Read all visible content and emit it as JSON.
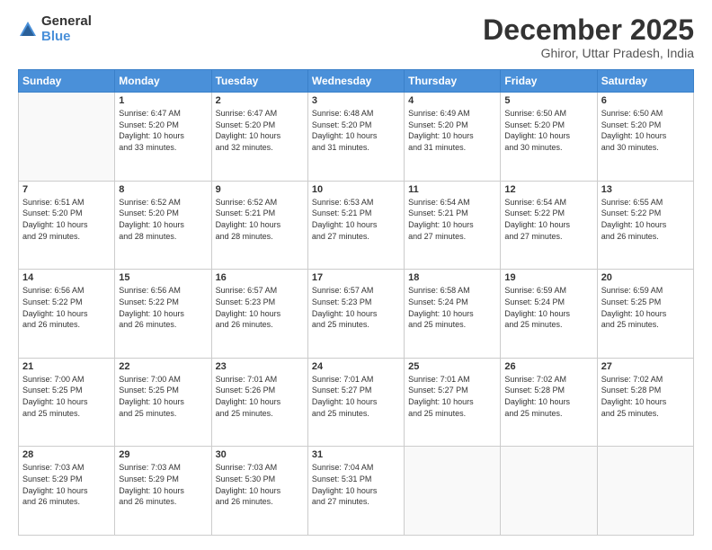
{
  "logo": {
    "general": "General",
    "blue": "Blue"
  },
  "header": {
    "month": "December 2025",
    "location": "Ghiror, Uttar Pradesh, India"
  },
  "weekdays": [
    "Sunday",
    "Monday",
    "Tuesday",
    "Wednesday",
    "Thursday",
    "Friday",
    "Saturday"
  ],
  "weeks": [
    [
      {
        "day": "",
        "info": ""
      },
      {
        "day": "1",
        "info": "Sunrise: 6:47 AM\nSunset: 5:20 PM\nDaylight: 10 hours\nand 33 minutes."
      },
      {
        "day": "2",
        "info": "Sunrise: 6:47 AM\nSunset: 5:20 PM\nDaylight: 10 hours\nand 32 minutes."
      },
      {
        "day": "3",
        "info": "Sunrise: 6:48 AM\nSunset: 5:20 PM\nDaylight: 10 hours\nand 31 minutes."
      },
      {
        "day": "4",
        "info": "Sunrise: 6:49 AM\nSunset: 5:20 PM\nDaylight: 10 hours\nand 31 minutes."
      },
      {
        "day": "5",
        "info": "Sunrise: 6:50 AM\nSunset: 5:20 PM\nDaylight: 10 hours\nand 30 minutes."
      },
      {
        "day": "6",
        "info": "Sunrise: 6:50 AM\nSunset: 5:20 PM\nDaylight: 10 hours\nand 30 minutes."
      }
    ],
    [
      {
        "day": "7",
        "info": "Sunrise: 6:51 AM\nSunset: 5:20 PM\nDaylight: 10 hours\nand 29 minutes."
      },
      {
        "day": "8",
        "info": "Sunrise: 6:52 AM\nSunset: 5:20 PM\nDaylight: 10 hours\nand 28 minutes."
      },
      {
        "day": "9",
        "info": "Sunrise: 6:52 AM\nSunset: 5:21 PM\nDaylight: 10 hours\nand 28 minutes."
      },
      {
        "day": "10",
        "info": "Sunrise: 6:53 AM\nSunset: 5:21 PM\nDaylight: 10 hours\nand 27 minutes."
      },
      {
        "day": "11",
        "info": "Sunrise: 6:54 AM\nSunset: 5:21 PM\nDaylight: 10 hours\nand 27 minutes."
      },
      {
        "day": "12",
        "info": "Sunrise: 6:54 AM\nSunset: 5:22 PM\nDaylight: 10 hours\nand 27 minutes."
      },
      {
        "day": "13",
        "info": "Sunrise: 6:55 AM\nSunset: 5:22 PM\nDaylight: 10 hours\nand 26 minutes."
      }
    ],
    [
      {
        "day": "14",
        "info": "Sunrise: 6:56 AM\nSunset: 5:22 PM\nDaylight: 10 hours\nand 26 minutes."
      },
      {
        "day": "15",
        "info": "Sunrise: 6:56 AM\nSunset: 5:22 PM\nDaylight: 10 hours\nand 26 minutes."
      },
      {
        "day": "16",
        "info": "Sunrise: 6:57 AM\nSunset: 5:23 PM\nDaylight: 10 hours\nand 26 minutes."
      },
      {
        "day": "17",
        "info": "Sunrise: 6:57 AM\nSunset: 5:23 PM\nDaylight: 10 hours\nand 25 minutes."
      },
      {
        "day": "18",
        "info": "Sunrise: 6:58 AM\nSunset: 5:24 PM\nDaylight: 10 hours\nand 25 minutes."
      },
      {
        "day": "19",
        "info": "Sunrise: 6:59 AM\nSunset: 5:24 PM\nDaylight: 10 hours\nand 25 minutes."
      },
      {
        "day": "20",
        "info": "Sunrise: 6:59 AM\nSunset: 5:25 PM\nDaylight: 10 hours\nand 25 minutes."
      }
    ],
    [
      {
        "day": "21",
        "info": "Sunrise: 7:00 AM\nSunset: 5:25 PM\nDaylight: 10 hours\nand 25 minutes."
      },
      {
        "day": "22",
        "info": "Sunrise: 7:00 AM\nSunset: 5:25 PM\nDaylight: 10 hours\nand 25 minutes."
      },
      {
        "day": "23",
        "info": "Sunrise: 7:01 AM\nSunset: 5:26 PM\nDaylight: 10 hours\nand 25 minutes."
      },
      {
        "day": "24",
        "info": "Sunrise: 7:01 AM\nSunset: 5:27 PM\nDaylight: 10 hours\nand 25 minutes."
      },
      {
        "day": "25",
        "info": "Sunrise: 7:01 AM\nSunset: 5:27 PM\nDaylight: 10 hours\nand 25 minutes."
      },
      {
        "day": "26",
        "info": "Sunrise: 7:02 AM\nSunset: 5:28 PM\nDaylight: 10 hours\nand 25 minutes."
      },
      {
        "day": "27",
        "info": "Sunrise: 7:02 AM\nSunset: 5:28 PM\nDaylight: 10 hours\nand 25 minutes."
      }
    ],
    [
      {
        "day": "28",
        "info": "Sunrise: 7:03 AM\nSunset: 5:29 PM\nDaylight: 10 hours\nand 26 minutes."
      },
      {
        "day": "29",
        "info": "Sunrise: 7:03 AM\nSunset: 5:29 PM\nDaylight: 10 hours\nand 26 minutes."
      },
      {
        "day": "30",
        "info": "Sunrise: 7:03 AM\nSunset: 5:30 PM\nDaylight: 10 hours\nand 26 minutes."
      },
      {
        "day": "31",
        "info": "Sunrise: 7:04 AM\nSunset: 5:31 PM\nDaylight: 10 hours\nand 27 minutes."
      },
      {
        "day": "",
        "info": ""
      },
      {
        "day": "",
        "info": ""
      },
      {
        "day": "",
        "info": ""
      }
    ]
  ]
}
